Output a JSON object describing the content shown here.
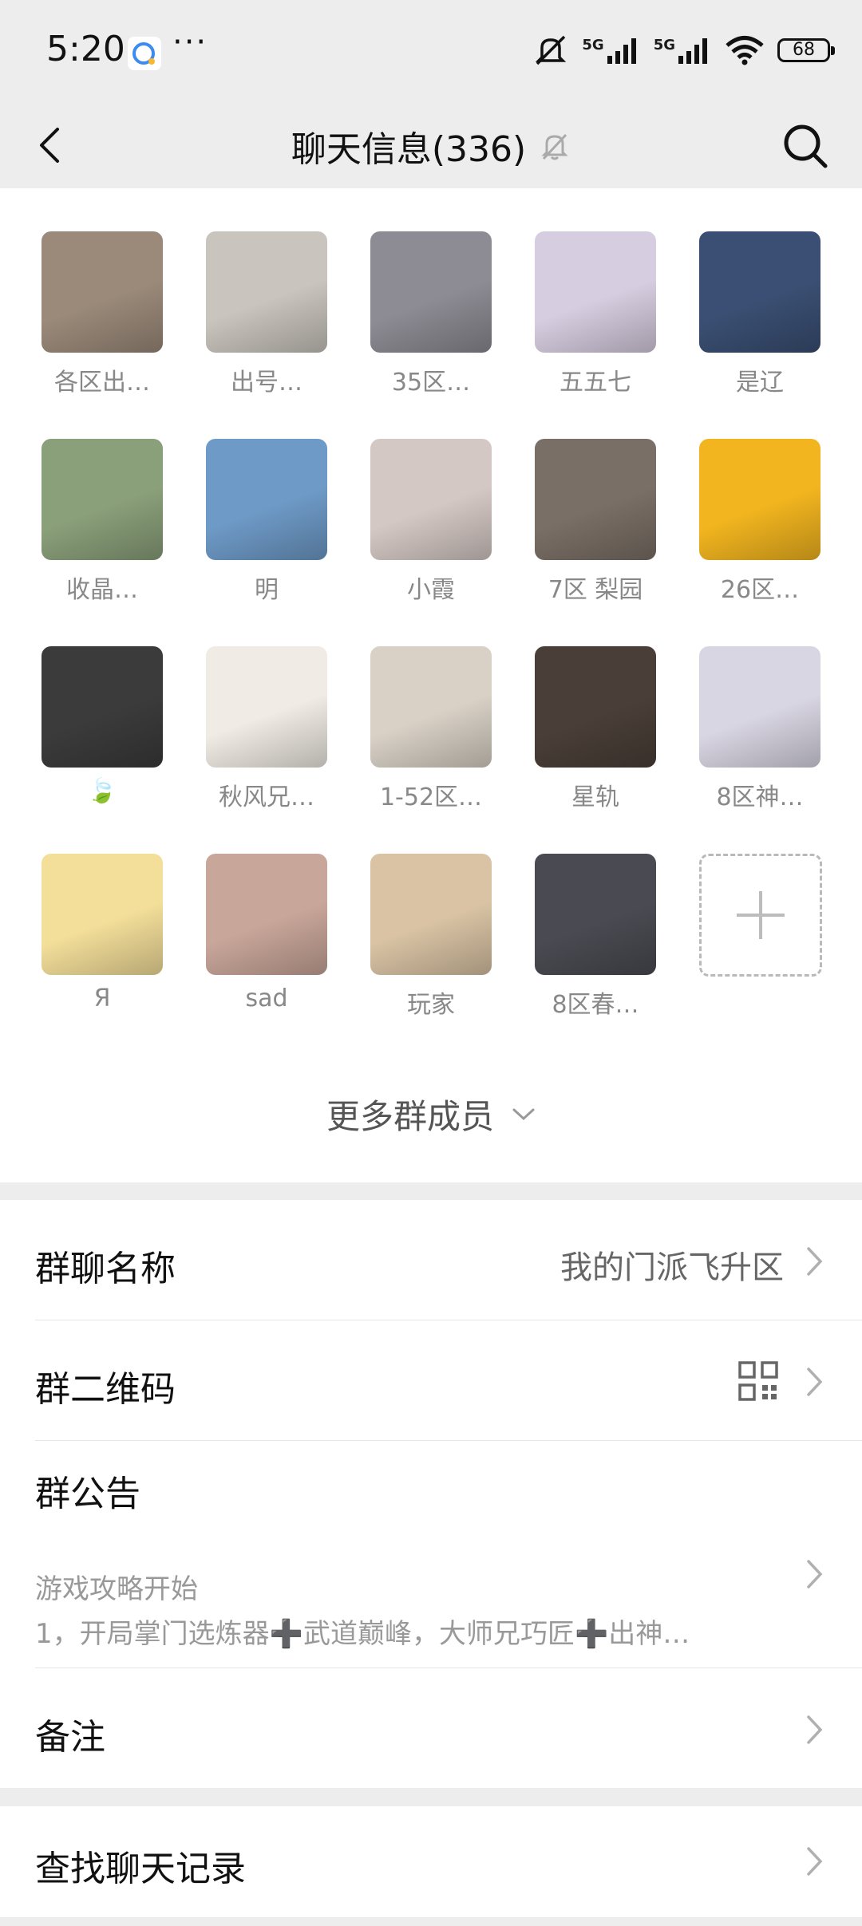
{
  "status_bar": {
    "time": "5:20",
    "dots": "···",
    "network_1": "5G",
    "network_2": "5G",
    "battery": "68",
    "icons": [
      "app-icon",
      "mute-icon",
      "signal-icon",
      "signal-icon",
      "wifi-icon",
      "battery-icon"
    ]
  },
  "header": {
    "title": "聊天信息(336)",
    "icons": [
      "back-icon",
      "bell-off-icon",
      "search-icon"
    ]
  },
  "members": [
    {
      "name": "各区出…",
      "color": "#9b8a7a"
    },
    {
      "name": "出号…",
      "color": "#c9c4bd"
    },
    {
      "name": "35区…",
      "color": "#8d8b93"
    },
    {
      "name": "五五七",
      "color": "#d7cde0"
    },
    {
      "name": "是辽",
      "color": "#3a4f73"
    },
    {
      "name": "收晶…",
      "color": "#8aa07a"
    },
    {
      "name": "明",
      "color": "#6e9ac7"
    },
    {
      "name": "小霞",
      "color": "#d4c8c4"
    },
    {
      "name": "7区 梨园",
      "color": "#7a6f66"
    },
    {
      "name": "26区…",
      "color": "#f2b51f"
    },
    {
      "name": "🍃",
      "color": "#3b3b3b"
    },
    {
      "name": "秋风兄…",
      "color": "#f0ebe4"
    },
    {
      "name": "1-52区…",
      "color": "#d9d1c6"
    },
    {
      "name": "星轨",
      "color": "#4a3f38"
    },
    {
      "name": "8区神…",
      "color": "#d9d6e3"
    },
    {
      "name": "Я",
      "color": "#f4df9a"
    },
    {
      "name": "sad",
      "color": "#c9a69a"
    },
    {
      "name": "玩家",
      "color": "#d9c3a4"
    },
    {
      "name": "8区春…",
      "color": "#4a4a52"
    }
  ],
  "add_member_icon": "plus-icon",
  "more_members": "更多群成员",
  "settings": {
    "group_name_label": "群聊名称",
    "group_name_value": "我的门派飞升区",
    "qr_label": "群二维码",
    "notice_label": "群公告",
    "notice_line1": "游戏攻略开始",
    "notice_line2": "1，开局掌门选炼器➕武道巅峰，大师兄巧匠➕出神…",
    "remark_label": "备注",
    "search_history_label": "查找聊天记录"
  }
}
